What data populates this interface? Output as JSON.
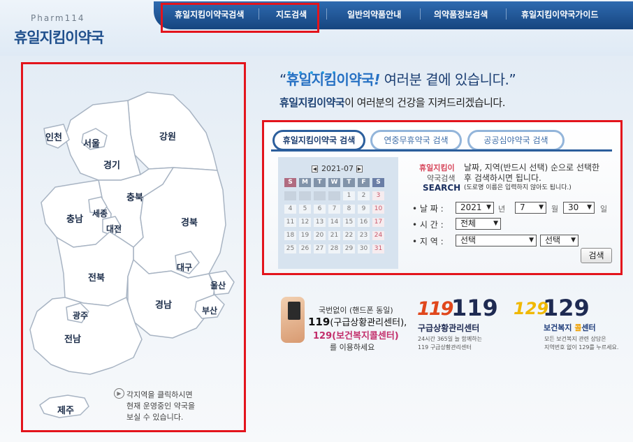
{
  "brand": {
    "english": "Pharm114",
    "korean": "휴일지킴이약국"
  },
  "nav": [
    "휴일지킴이약국검색",
    "지도검색",
    "일반의약품안내",
    "의약품정보검색",
    "휴일지킴이약국가이드"
  ],
  "slogan": {
    "quote_open": "“",
    "strong": "휴일지킴이약국",
    "bang": "!",
    "rest": "여러분 곁에 있습니다.”"
  },
  "subline": {
    "strong": "휴일지킴이약국",
    "rest": "이 여러분의 건강을 지켜드리겠습니다."
  },
  "map": {
    "regions": [
      "인천",
      "서울",
      "경기",
      "강원",
      "충북",
      "충남",
      "세종",
      "대전",
      "경북",
      "대구",
      "전북",
      "울산",
      "경남",
      "부산",
      "광주",
      "전남",
      "제주"
    ],
    "note": [
      "각지역을 클릭하시면",
      "현재 운영중인 약국을",
      "보실 수 있습니다."
    ]
  },
  "tabs": [
    "휴일지킴이약국 검색",
    "연중무휴약국 검색",
    "공공심야약국 검색"
  ],
  "calendar": {
    "month_label": "2021-07",
    "prev": "◀",
    "next": "▶",
    "weekday_heads": [
      "S",
      "M",
      "T",
      "W",
      "T",
      "F",
      "S"
    ],
    "days": [
      "",
      "",
      "",
      "",
      "1",
      "2",
      "3",
      "4",
      "5",
      "6",
      "7",
      "8",
      "9",
      "10",
      "11",
      "12",
      "13",
      "14",
      "15",
      "16",
      "17",
      "18",
      "19",
      "20",
      "21",
      "22",
      "23",
      "24",
      "25",
      "26",
      "27",
      "28",
      "29",
      "30",
      "31"
    ]
  },
  "search_info": {
    "brand1": "휴일지킴이",
    "brand2": "약국검색",
    "brand3": "SEARCH",
    "line1": "날짜, 지역(반드시 선택) 순으로 선택한",
    "line2": "후 검색하시면 됩니다.",
    "line3": "(도로명 이름은 입력하지 않아도 됩니다.)"
  },
  "form": {
    "date_label": "• 날 짜 :",
    "time_label": "• 시 간 :",
    "region_label": "• 지 역 :",
    "year": "2021",
    "year_unit": "년",
    "month": "7",
    "month_unit": "월",
    "day": "30",
    "day_unit": "일",
    "time": "전체",
    "region1": "선택",
    "region2": "선택",
    "search_button": "검색"
  },
  "banner": {
    "phone_line1": "국번없이 (핸드폰 동일)",
    "phone_line2_num": "119",
    "phone_line2_rest": "(구급상황관리센터),",
    "phone_line3": "129(보건복지콜센터)",
    "phone_line4": "를 이용하세요",
    "logo119": "119",
    "num119": "119",
    "center119": "구급상황관리센터",
    "desc119_1": "24시간 365일 늘 함께하는",
    "desc119_2": "119 구급상황관리센터",
    "logo129": "129",
    "num129": "129",
    "center129_a": "보건복지 ",
    "center129_b": "콜",
    "center129_c": "센터",
    "desc129_1": "모든 보건복지 관련 상담은",
    "desc129_2": "지역번호 없이 129를 누르세요."
  },
  "colors": {
    "nav_bg": "#1f5496",
    "highlight": "#e3141c",
    "brand_blue": "#1f4f8c",
    "map_fill": "#ffffff",
    "map_stroke": "#a8b4c3"
  }
}
